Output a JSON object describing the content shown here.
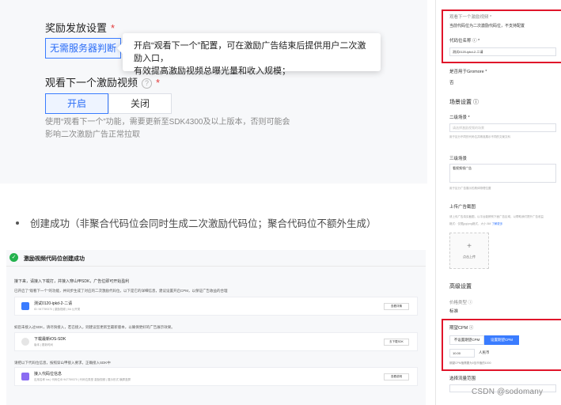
{
  "top_card": {
    "reward_section_label": "奖励发放设置",
    "required_mark": "*",
    "no_server_button": "无需服务器判断",
    "tooltip_line1": "开启“观看下一个”配置，可在激励广告结束后提供用户二次激励入口，",
    "tooltip_line2": "有效提高激励视频总曝光量和收入规模；",
    "next_video_label": "观看下一个激励视频",
    "help_icon": "?",
    "on_button": "开启",
    "off_button": "关闭",
    "hint_line1": "使用“观看下一个”功能，需要更新至SDK4300及以上版本，否则可能会",
    "hint_line2": "影响二次激励广告正常拉取"
  },
  "bullet_text": "创建成功（非聚合代码位会同时生成二次激励代码位；聚合代码位不额外生成）",
  "success_screen": {
    "title": "激励视频代码位创建成功",
    "check_icon": "✓",
    "subtitle": "接下来，请接入下载打，并接入穿山甲SDK，广告位即可开始盈利",
    "step1_text": "已开启了“观看下一个”的功能，并同步生成了对应的二次激励代码位，以下是它的详细信息，建议设置开启CPM，以保证广告收益的合理",
    "card1_title": "测试0120-ipkd-2-二请",
    "card1_meta": "ID: 947759370  |  激励视频  |  5A 公开类",
    "card1_button": "查看详情",
    "step2_text": "如您未接入过SDK，请尽快接入，若已接入，则建议您更新至最新版本，以确保更好的广告展示效果。",
    "card2_title": "下载最新iOS-SDK",
    "card2_meta": "版本  |  更新时间",
    "card2_button": "去下载SDK",
    "step3_text": "请把以下代码位信息，按照穿山甲接入要求，正确接入SDK中",
    "card3_title": "接入代码位信息",
    "card3_meta": "应用名称  ios  |  代码位ID  947759370  |  代码位类型  激励视频  |  展示形式  横屏竖屏",
    "card3_button": "查看说明"
  },
  "right_panel": {
    "next_label": "观看下一个激励视频 *",
    "next_hint": "当前代码位为二次激励代码位，不支持配置",
    "code_name_label": "代码位名称 ⓘ *",
    "code_name_value": "测试0120-ipkd-2-二请",
    "gromore_label": "是否用于Gromore *",
    "gromore_value": "否",
    "scene_section": "场景设置 ⓘ",
    "second_scene_label": "二级场景 *",
    "second_scene_placeholder": "请选择激励视频的场景",
    "second_scene_hint": "用于区分不同的代码位并精准展示不同的文案文科",
    "third_scene_label": "三级场景",
    "third_scene_value": "看视频领广告",
    "third_scene_hint": "用于区分广告展示的具体物理位置",
    "screenshot_label": "上传广告截图",
    "screenshot_hint1": "请上传广告真实截图，以平台能辨别下面广告区域，以帮助我们提升广告收益",
    "screenshot_hint2": "格式：仅限jpg/png格式，大小 5M",
    "screenshot_link": "了解更多",
    "upload_plus": "+",
    "upload_text": "点击上传",
    "advanced_section": "高级设置",
    "price_label": "价格类型 ⓘ",
    "price_value": "标准",
    "cpm_label": "期望CPM ⓘ",
    "cpm_off_button": "不设置期望CPM",
    "cpm_on_button": "设置期望CPM",
    "cpm_value": "10.00",
    "cpm_unit": "人民币",
    "cpm_hint": "期望CPM值需要为0至币值的1000",
    "more_label": "选择流量范围"
  },
  "watermark": "CSDN @sodomany",
  "colors": {
    "accent": "#3a7cff",
    "highlight_border": "#e0152a",
    "success": "#23b14d"
  }
}
